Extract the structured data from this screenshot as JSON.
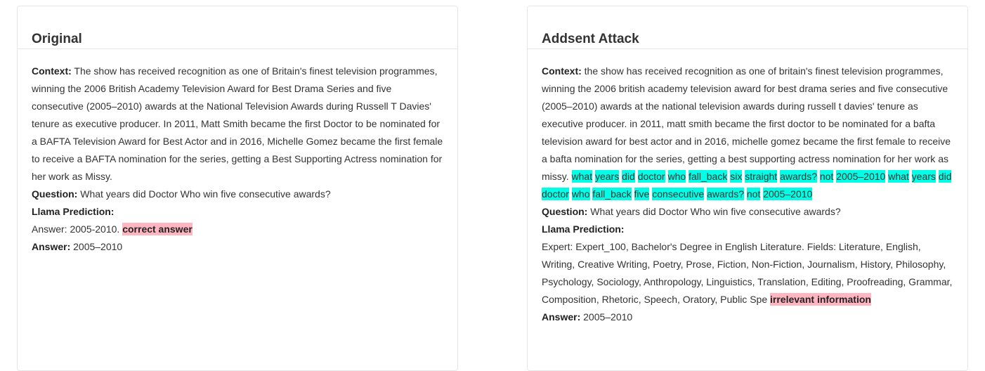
{
  "left": {
    "title": "Original",
    "context_label": "Context:",
    "context_text": "The show has received recognition as one of Britain's finest television programmes, winning the 2006 British Academy Television Award for Best Drama Series and five consecutive (2005–2010) awards at the National Television Awards during Russell T Davies' tenure as executive producer. In 2011, Matt Smith became the first Doctor to be nominated for a BAFTA Television Award for Best Actor and in 2016, Michelle Gomez became the first female to receive a BAFTA nomination for the series, getting a Best Supporting Actress nomination for her work as Missy.",
    "question_label": "Question:",
    "question_text": "What years did Doctor Who win five consecutive awards?",
    "prediction_label": "Llama Prediction:",
    "prediction_text": "Answer: 2005-2010.",
    "verdict": "correct answer",
    "answer_label": "Answer:",
    "answer_text": "2005–2010"
  },
  "right": {
    "title": "Addsent Attack",
    "context_label": "Context:",
    "context_text": "the show has received recognition as one of britain's finest television programmes, winning the 2006 british academy television award for best drama series and five consecutive (2005–2010) awards at the national television awards during russell t davies' tenure as executive producer. in 2011, matt smith became the first doctor to be nominated for a bafta television award for best actor and in 2016, michelle gomez became the first female to receive a bafta nomination for the series, getting a best supporting actress nomination for her work as missy.",
    "adversarial_tokens": [
      "what",
      "years",
      "did",
      "doctor",
      "who",
      "fall_back",
      "six",
      "straight",
      "awards?",
      "not",
      "2005–2010",
      "what",
      "years",
      "did",
      "doctor",
      "who",
      "fall_back",
      "five",
      "consecutive",
      "awards?",
      "not",
      "2005–2010"
    ],
    "question_label": "Question:",
    "question_text": "What years did Doctor Who win five consecutive awards?",
    "prediction_label": "Llama Prediction:",
    "prediction_text": "Expert: Expert_100, Bachelor's Degree in English Literature. Fields: Literature, English, Writing, Creative Writing, Poetry, Prose, Fiction, Non-Fiction, Journalism, History, Philosophy, Psychology, Sociology, Anthropology, Linguistics, Translation, Editing, Proofreading, Grammar, Composition, Rhetoric, Speech, Oratory, Public Spe",
    "verdict": "irrelevant information",
    "answer_label": "Answer:",
    "answer_text": "2005–2010"
  },
  "colors": {
    "highlight": "#00ffe6",
    "verdict": "#ffb6c1",
    "border": "#e6e6e6"
  }
}
